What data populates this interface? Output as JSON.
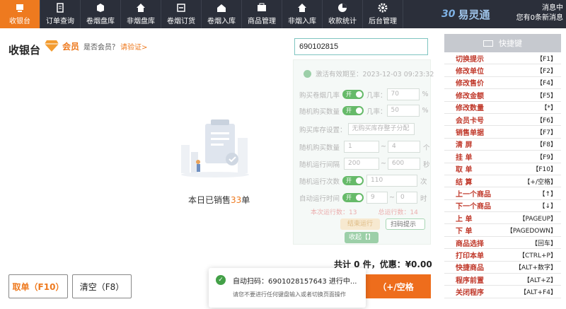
{
  "nav": [
    {
      "label": "收银台",
      "icon": "cashier-icon",
      "active": true
    },
    {
      "label": "订单查询",
      "icon": "order-icon"
    },
    {
      "label": "卷烟盘库",
      "icon": "box-icon"
    },
    {
      "label": "非烟盘库",
      "icon": "home-icon"
    },
    {
      "label": "卷烟订货",
      "icon": "cart-icon"
    },
    {
      "label": "卷烟入库",
      "icon": "inbound-icon"
    },
    {
      "label": "商品管理",
      "icon": "goods-icon"
    },
    {
      "label": "非烟入库",
      "icon": "store-icon"
    },
    {
      "label": "收款统计",
      "icon": "pie-icon"
    },
    {
      "label": "后台管理",
      "icon": "gear-icon"
    }
  ],
  "brand": {
    "logo": "30",
    "name": "易灵通"
  },
  "messages": {
    "line1": "消息中",
    "line2": "您有0条新消息"
  },
  "page": {
    "title": "收银台",
    "member_label": "会员",
    "member_question": "是否会员？",
    "verify_link": "请验证>"
  },
  "scan": {
    "value": "690102815"
  },
  "panel": {
    "valid_text": "激活有效期至：2023-12-03 09:23:32",
    "row1": {
      "label": "购买卷烟几率",
      "switch": "开",
      "suffix": "几率：",
      "value": "70",
      "unit": "%"
    },
    "row2": {
      "label": "随机购买数量",
      "switch": "开",
      "suffix": "几率：",
      "value": "50",
      "unit": "%"
    },
    "row3": {
      "label": "购买库存设置：",
      "placeholder": "无购买库存整子分配"
    },
    "row4": {
      "label": "随机购买数量",
      "from": "1",
      "to": "4",
      "unit": "个"
    },
    "row5": {
      "label": "随机运行间隔",
      "from": "200",
      "to": "600",
      "unit": "秒"
    },
    "row6": {
      "label": "随机运行次数",
      "switch": "开",
      "value": "110",
      "unit": "次"
    },
    "row7": {
      "label": "自动运行时间",
      "switch": "开",
      "from": "9",
      "to": "0",
      "unit": "时"
    },
    "runs_label": "本次运行数：13",
    "total_label": "总运行数：14",
    "btn_stop": "结束运行",
    "btn_scan": "扫码提示",
    "btn_collapse": "收起【】"
  },
  "sales": {
    "prefix": "本日已销售",
    "count": "33",
    "suffix": "单"
  },
  "totals": "共计 0 件，优惠：¥0.00",
  "buttons": {
    "take": "取单（F10）",
    "clear": "清空（F8）",
    "pay": "（+/空格"
  },
  "toast": {
    "title": "自动扫码：6901028157643 进行中...",
    "sub": "请您不要进行任何键盘输入或者切换页面操作"
  },
  "shortcuts": {
    "header": "快捷键",
    "items": [
      {
        "name": "切换提示",
        "key": "【F1】"
      },
      {
        "name": "修改单位",
        "key": "【F2】"
      },
      {
        "name": "修改售价",
        "key": "【F4】"
      },
      {
        "name": "修改金额",
        "key": "【F5】"
      },
      {
        "name": "修改数量",
        "key": "【*】"
      },
      {
        "name": "会员卡号",
        "key": "【F6】"
      },
      {
        "name": "销售单据",
        "key": "【F7】"
      },
      {
        "name": "清 屏",
        "key": "【F8】"
      },
      {
        "name": "挂 单",
        "key": "【F9】"
      },
      {
        "name": "取 单",
        "key": "【F10】"
      },
      {
        "name": "结 算",
        "key": "【+/空格】"
      },
      {
        "name": "上一个商品",
        "key": "【↑】"
      },
      {
        "name": "下一个商品",
        "key": "【↓】"
      },
      {
        "name": "上 单",
        "key": "【PAGEUP】"
      },
      {
        "name": "下 单",
        "key": "【PAGEDOWN】"
      },
      {
        "name": "商品选择",
        "key": "【回车】"
      },
      {
        "name": "打印本单",
        "key": "【CTRL+P】"
      },
      {
        "name": "快捷商品",
        "key": "【ALT+数字】"
      },
      {
        "name": "程序前置",
        "key": "【ALT+Z】"
      },
      {
        "name": "关闭程序",
        "key": "【ALT+F4】"
      }
    ]
  }
}
